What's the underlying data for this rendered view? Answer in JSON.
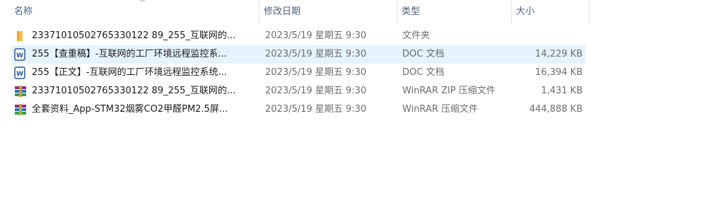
{
  "columns": {
    "name": "名称",
    "date": "修改日期",
    "type": "类型",
    "size": "大小"
  },
  "sort_indicator": "^",
  "files": [
    {
      "icon": "folder-icon",
      "name": "23371010502765330122 89_255_互联网的...",
      "date": "2023/5/19 星期五 9:30",
      "type": "文件夹",
      "size": ""
    },
    {
      "icon": "word-doc-icon",
      "name": "255【查重稿】-互联网的工厂环境远程监控系...",
      "date": "2023/5/19 星期五 9:30",
      "type": "DOC 文档",
      "size": "14,229 KB",
      "selected": true
    },
    {
      "icon": "word-doc-icon",
      "name": "255【正文】-互联网的工厂环境远程监控系统...",
      "date": "2023/5/19 星期五 9:30",
      "type": "DOC 文档",
      "size": "16,394 KB"
    },
    {
      "icon": "winrar-archive-icon",
      "name": "23371010502765330122 89_255_互联网的...",
      "date": "2023/5/19 星期五 9:30",
      "type": "WinRAR ZIP 压缩文件",
      "size": "1,431 KB"
    },
    {
      "icon": "winrar-archive-icon",
      "name": "全套资料_App-STM32烟雾CO2甲醛PM2.5屏...",
      "date": "2023/5/19 星期五 9:30",
      "type": "WinRAR 压缩文件",
      "size": "444,888 KB"
    }
  ]
}
